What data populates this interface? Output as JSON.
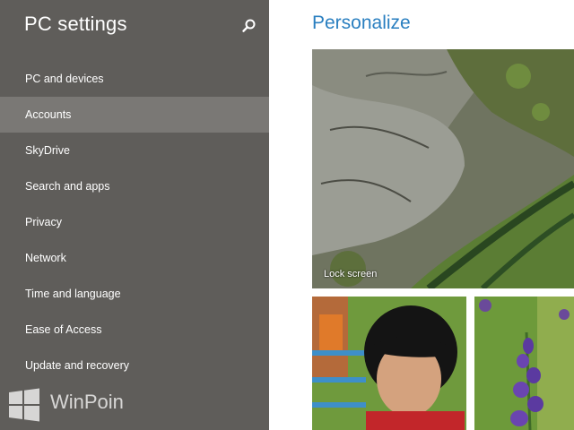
{
  "sidebar": {
    "title": "PC settings",
    "search_icon": "search-icon",
    "items": [
      {
        "label": "PC and devices",
        "selected": false
      },
      {
        "label": "Accounts",
        "selected": true
      },
      {
        "label": "SkyDrive",
        "selected": false
      },
      {
        "label": "Search and apps",
        "selected": false
      },
      {
        "label": "Privacy",
        "selected": false
      },
      {
        "label": "Network",
        "selected": false
      },
      {
        "label": "Time and language",
        "selected": false
      },
      {
        "label": "Ease of Access",
        "selected": false
      },
      {
        "label": "Update and recovery",
        "selected": false
      }
    ]
  },
  "watermark": {
    "text": "WinPoin"
  },
  "main": {
    "title": "Personalize",
    "lock_screen": {
      "label": "Lock screen"
    }
  },
  "colors": {
    "sidebar_bg": "#5f5d5a",
    "selected_bg": "#7a7875",
    "accent": "#2a7fc0"
  }
}
